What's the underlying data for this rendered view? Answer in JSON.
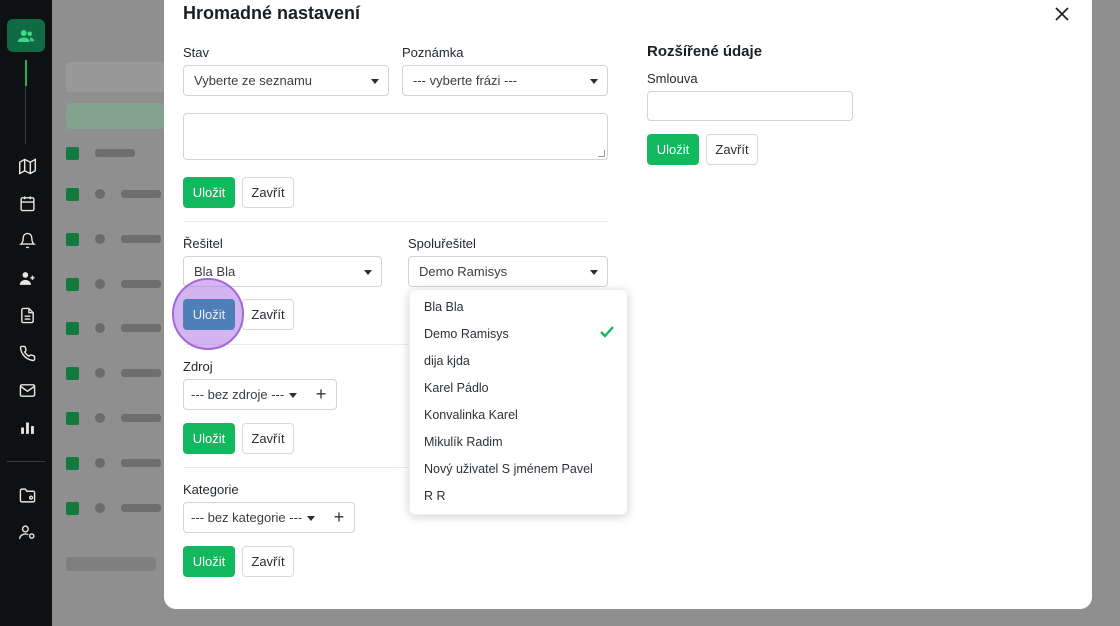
{
  "modal": {
    "title": "Hromadné nastavení",
    "stav": {
      "label": "Stav",
      "value": "Vyberte ze seznamu"
    },
    "poznamka": {
      "label": "Poznámka",
      "value": "--- vyberte frázi ---"
    },
    "resitel": {
      "label": "Řešitel",
      "value": "Bla Bla"
    },
    "spoluresitel": {
      "label": "Spoluřešitel",
      "value": "Demo Ramisys"
    },
    "zdroj": {
      "label": "Zdroj",
      "value": "--- bez zdroje ---"
    },
    "kategorie": {
      "label": "Kategorie",
      "value": "--- bez kategorie ---"
    },
    "rozsirene": {
      "title": "Rozšířené údaje",
      "smlouva_label": "Smlouva"
    },
    "save_label": "Uložit",
    "close_label": "Zavřít",
    "plus_label": "+"
  },
  "dropdown": {
    "items": [
      "Bla Bla",
      "Demo Ramisys",
      "dija kjda",
      "Karel Pádlo",
      "Konvalinka Karel",
      "Mikulík Radim",
      "Nový uživatel S jménem Pavel",
      "R R"
    ],
    "selected": "Demo Ramisys"
  },
  "colors": {
    "primary": "#12b85e",
    "sidebar": "#0f1011",
    "highlight": "#a168dc"
  },
  "icons": [
    "users-icon",
    "map-icon",
    "calendar-icon",
    "bell-icon",
    "user-plus-icon",
    "document-icon",
    "phone-icon",
    "mail-icon",
    "chart-icon",
    "folder-icon",
    "user-settings-icon",
    "close-icon",
    "check-icon"
  ]
}
